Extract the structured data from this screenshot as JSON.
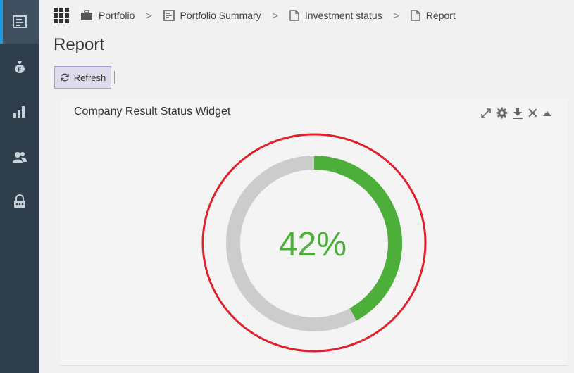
{
  "breadcrumb": {
    "items": [
      {
        "label": "Portfolio",
        "icon": "briefcase-icon"
      },
      {
        "label": "Portfolio Summary",
        "icon": "summary-icon"
      },
      {
        "label": "Investment status",
        "icon": "document-icon"
      },
      {
        "label": "Report",
        "icon": "document-icon"
      }
    ],
    "separator": ">"
  },
  "page": {
    "title": "Report"
  },
  "toolbar": {
    "refresh_label": "Refresh"
  },
  "widget": {
    "title": "Company Result Status Widget",
    "value_text": "42%",
    "progress": 0.42
  },
  "colors": {
    "sidebar": "#2f3e4d",
    "accent": "#1d9be0",
    "progress": "#4caf3a",
    "track": "#cccccc",
    "highlight": "#e0202a"
  }
}
